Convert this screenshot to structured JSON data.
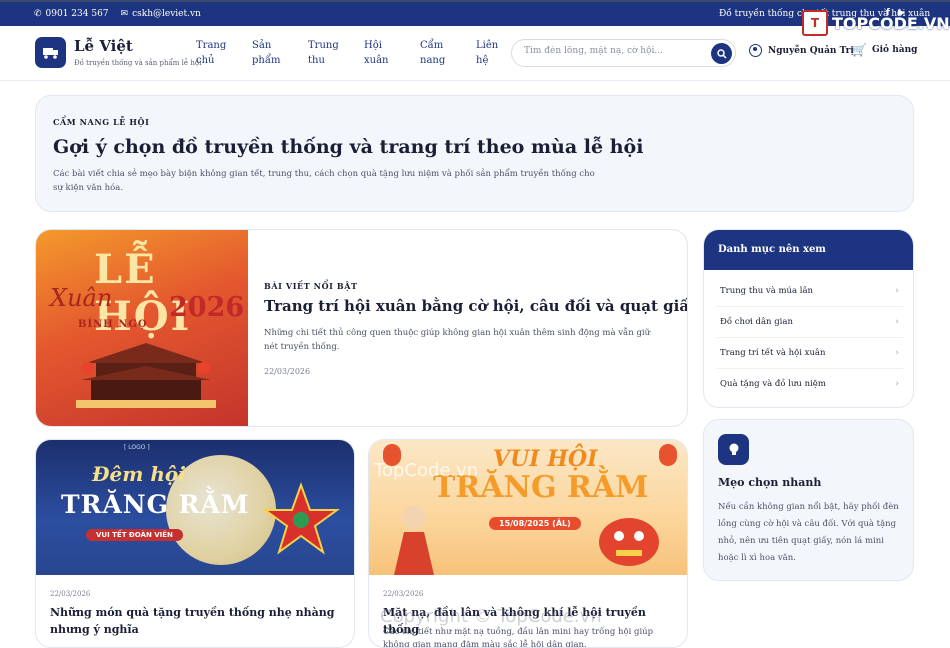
{
  "topbar": {
    "phone": "0901 234 567",
    "email": "cskh@leviet.vn",
    "promo": "Đồ truyền thống cho tết trung thu và hội xuân",
    "social": [
      "facebook",
      "youtube"
    ]
  },
  "header": {
    "brand": "Lễ Việt",
    "tagline": "Đồ truyền thống và sản phẩm lễ hội",
    "nav": [
      "Trang chủ",
      "Sản phẩm",
      "Trung thu",
      "Hội xuân",
      "Cẩm nang",
      "Liên hệ"
    ],
    "search_placeholder": "Tìm đèn lồng, mặt nạ, cờ hội...",
    "user": "Nguyễn Quản Trị",
    "cart": "Giỏ hàng"
  },
  "hero": {
    "kicker": "CẨM NANG LỄ HỘI",
    "title": "Gợi ý chọn đồ truyền thống và trang trí theo mùa lễ hội",
    "desc": "Các bài viết chia sẻ mẹo bày biện không gian tết, trung thu, cách chọn quà tặng lưu niệm và phối sản phẩm truyền thống cho sự kiện văn hóa."
  },
  "featured": {
    "image_text": [
      "LỄ HỘI",
      "Xuân",
      "2026",
      "BÍNH NGỌ"
    ],
    "kicker": "BÀI VIẾT NỔI BẬT",
    "title": "Trang trí hội xuân bằng cờ hội, câu đối và quạt giấy",
    "desc": "Những chi tiết thủ công quen thuộc giúp không gian hội xuân thêm sinh động mà vẫn giữ nét truyền thống.",
    "date": "22/03/2026"
  },
  "cards": [
    {
      "image_text": [
        "[ LOGO ]",
        "Đêm hội",
        "TRĂNG RẰM",
        "VUI TẾT ĐOÀN VIÊN"
      ],
      "date": "22/03/2026",
      "title": "Những món quà tặng truyền thống nhẹ nhàng nhưng ý nghĩa"
    },
    {
      "image_text": [
        "VUI HỘI",
        "TRĂNG RẰM",
        "15/08/2025 (ÂL)"
      ],
      "date": "22/03/2026",
      "title": "Mặt nạ, đầu lân và không khí lễ hội truyền thống",
      "desc": "Các chi tiết như mặt nạ tuồng, đầu lân mini hay trống hội giúp không gian mang đậm màu sắc lễ hội dân gian."
    }
  ],
  "sidebar": {
    "categories_title": "Danh mục nên xem",
    "categories": [
      "Trung thu và múa lân",
      "Đồ chơi dân gian",
      "Trang trí tết và hội xuân",
      "Quà tặng và đồ lưu niệm"
    ],
    "tip_title": "Mẹo chọn nhanh",
    "tip_desc": "Nếu cần không gian nổi bật, hãy phối đèn lồng cùng cờ hội và câu đối. Với quà tặng nhỏ, nên ưu tiên quạt giấy, nón lá mini hoặc lì xì hoa văn."
  },
  "watermark": {
    "top_box": "T",
    "top_text": "TOPCODE.VN",
    "middle": "TopCode.vn",
    "bottom": "Copyright © TopCode.vn"
  },
  "colors": {
    "primary": "#1d3580",
    "text": "#1a1f36",
    "muted": "#4b5165",
    "panel": "#f3f7fc"
  }
}
